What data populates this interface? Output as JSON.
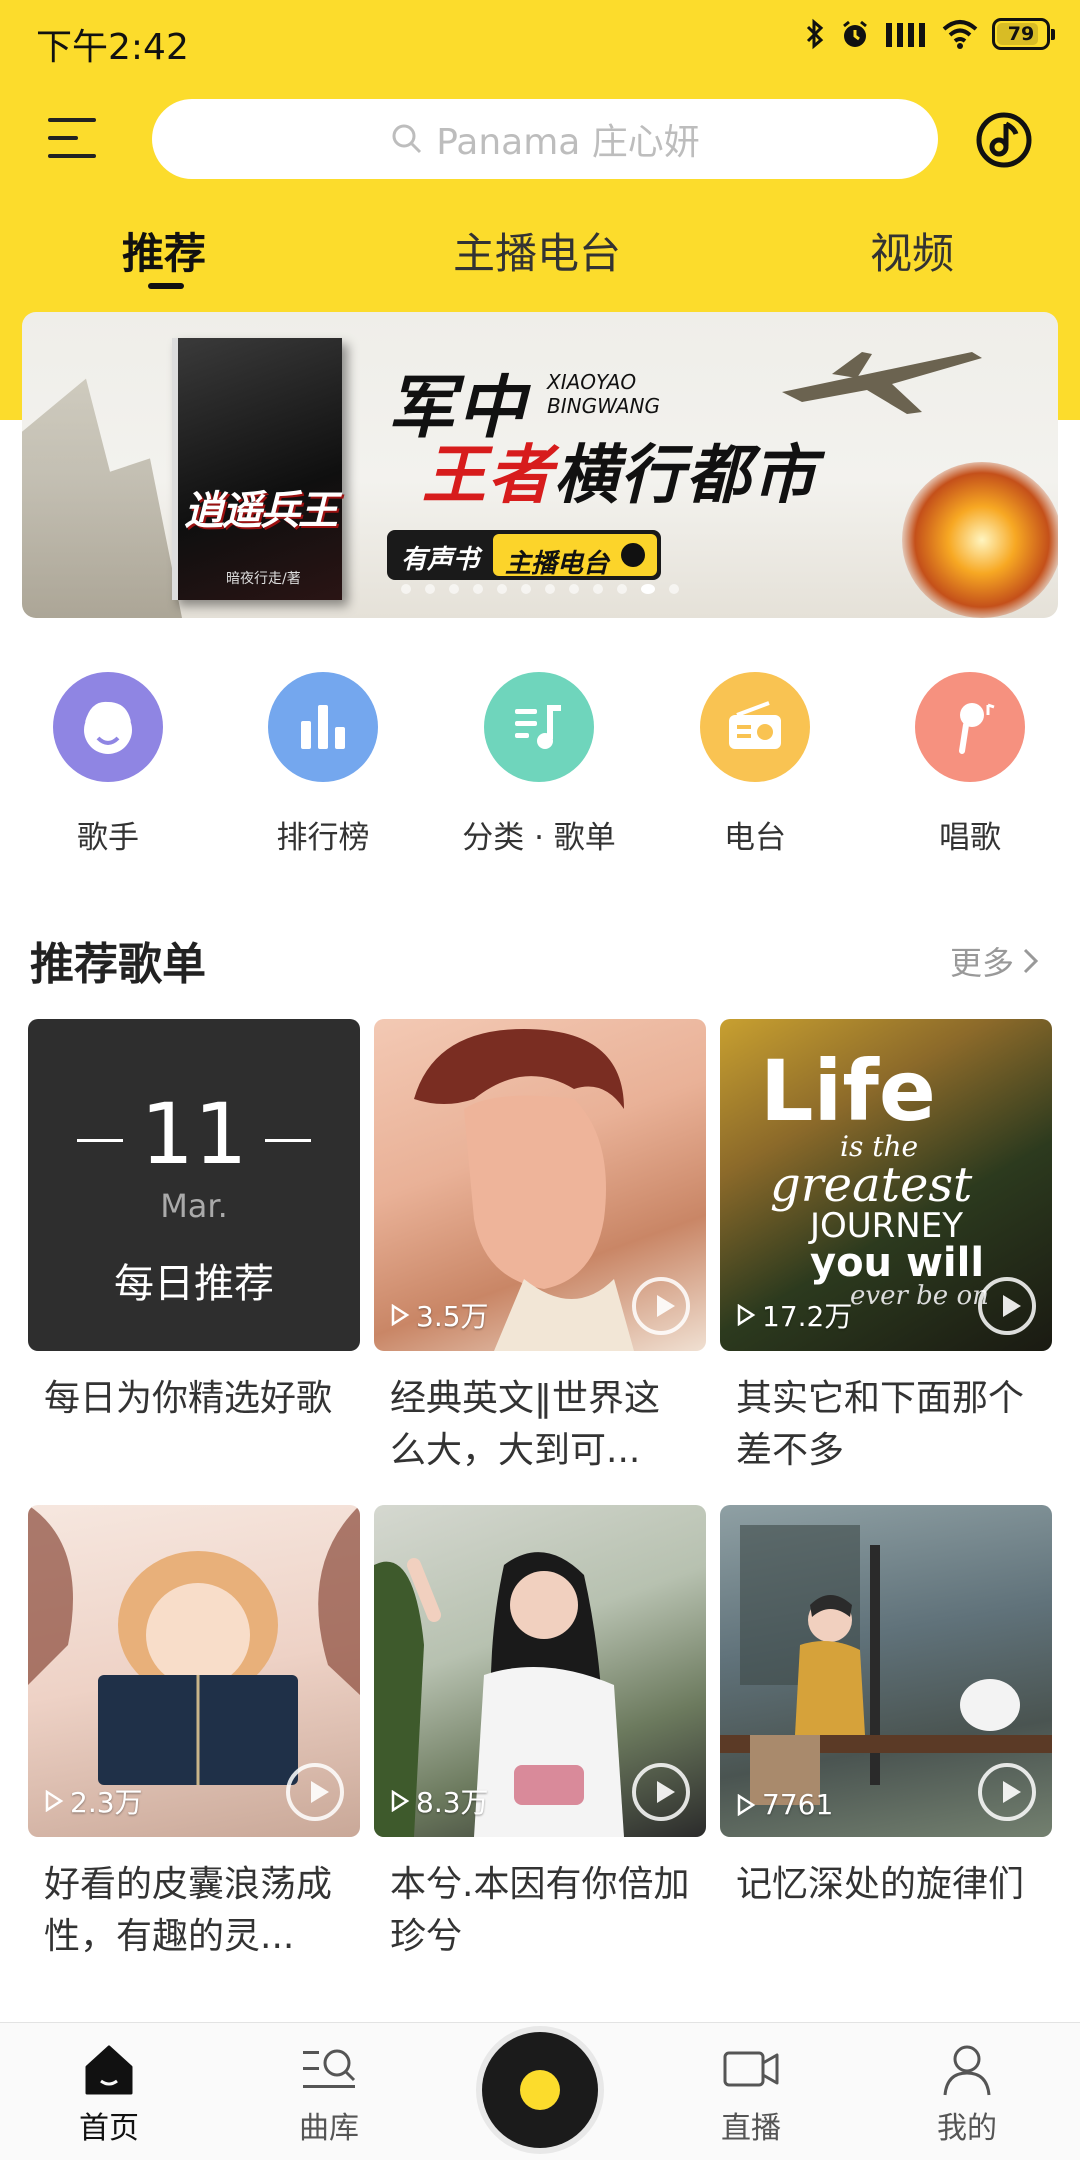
{
  "status_bar": {
    "time": "下午2:42",
    "battery": "79"
  },
  "search": {
    "placeholder": "Panama 庄心妍"
  },
  "tabs": [
    {
      "label": "推荐"
    },
    {
      "label": "主播电台"
    },
    {
      "label": "视频"
    }
  ],
  "banner": {
    "book_title": "逍遥兵王",
    "book_author": "暗夜行走/著",
    "headline_1": "军中",
    "pinyin_1": "XIAOYAO",
    "pinyin_2": "BINGWANG",
    "headline_2_red": "王者",
    "headline_2": "横行都市",
    "tag_1": "有声书",
    "tag_2": "主播电台"
  },
  "shortcuts": [
    {
      "label": "歌手",
      "color": "#8f85e3"
    },
    {
      "label": "排行榜",
      "color": "#74a7ee"
    },
    {
      "label": "分类 · 歌单",
      "color": "#6fd5bc"
    },
    {
      "label": "电台",
      "color": "#f9c352"
    },
    {
      "label": "唱歌",
      "color": "#f6917f"
    }
  ],
  "section": {
    "title": "推荐歌单",
    "more": "更多"
  },
  "playlists": [
    {
      "daily_day": "11",
      "daily_month": "Mar.",
      "daily_label": "每日推荐",
      "title": "每日为你精选好歌"
    },
    {
      "plays": "3.5万",
      "title": "经典英文‖世界这么大，大到可..."
    },
    {
      "plays": "17.2万",
      "title": "其实它和下面那个差不多",
      "cover_text": [
        "Life",
        "is the",
        "greatest",
        "JOURNEY",
        "you will",
        "ever be on"
      ]
    },
    {
      "plays": "2.3万",
      "title": "好看的皮囊浪荡成性，有趣的灵..."
    },
    {
      "plays": "8.3万",
      "title": "本兮.本因有你倍加珍兮"
    },
    {
      "plays": "7761",
      "title": "记忆深处的旋律们"
    }
  ],
  "bottom_nav": [
    {
      "label": "首页"
    },
    {
      "label": "曲库"
    },
    {
      "label": "直播"
    },
    {
      "label": "我的"
    }
  ],
  "colors": {
    "brand_yellow": "#fcdc2c"
  }
}
